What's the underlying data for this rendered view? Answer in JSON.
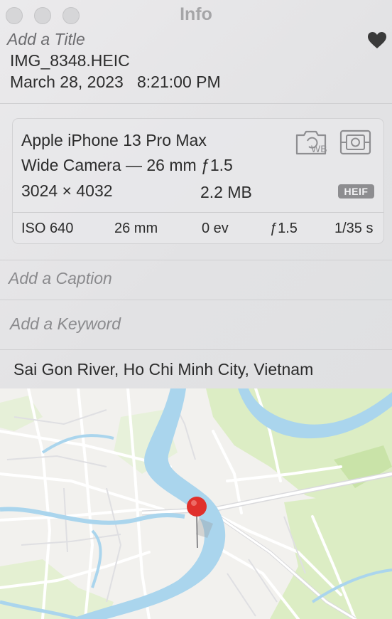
{
  "window": {
    "title": "Info"
  },
  "photo": {
    "title_placeholder": "Add a Title",
    "filename": "IMG_8348.HEIC",
    "date": "March 28, 2023",
    "time": "8:21:00 PM",
    "favorite": true
  },
  "camera": {
    "model": "Apple iPhone 13 Pro Max",
    "lens": "Wide Camera — 26 mm ƒ1.5",
    "dimensions": "3024 × 4032",
    "file_size": "2.2 MB",
    "format": "HEIF",
    "white_balance_icon_text": "WB",
    "exif": {
      "iso": "ISO 640",
      "focal_length": "26 mm",
      "exposure_bias": "0 ev",
      "aperture": "ƒ1.5",
      "shutter": "1/35 s"
    }
  },
  "caption_placeholder": "Add a Caption",
  "keyword_placeholder": "Add a Keyword",
  "location": "Sai Gon River, Ho Chi Minh City, Vietnam",
  "colors": {
    "heart": "#3a3a3a",
    "pin": "#e0302b",
    "water": "#a9d6ee",
    "park": "#d9ecc0",
    "road": "#ffffff",
    "format_badge": "#8d8d90"
  },
  "icons": {
    "heart": "heart-icon",
    "white_balance": "white-balance-icon",
    "metering": "metering-mode-icon",
    "pin": "map-pin-icon"
  }
}
